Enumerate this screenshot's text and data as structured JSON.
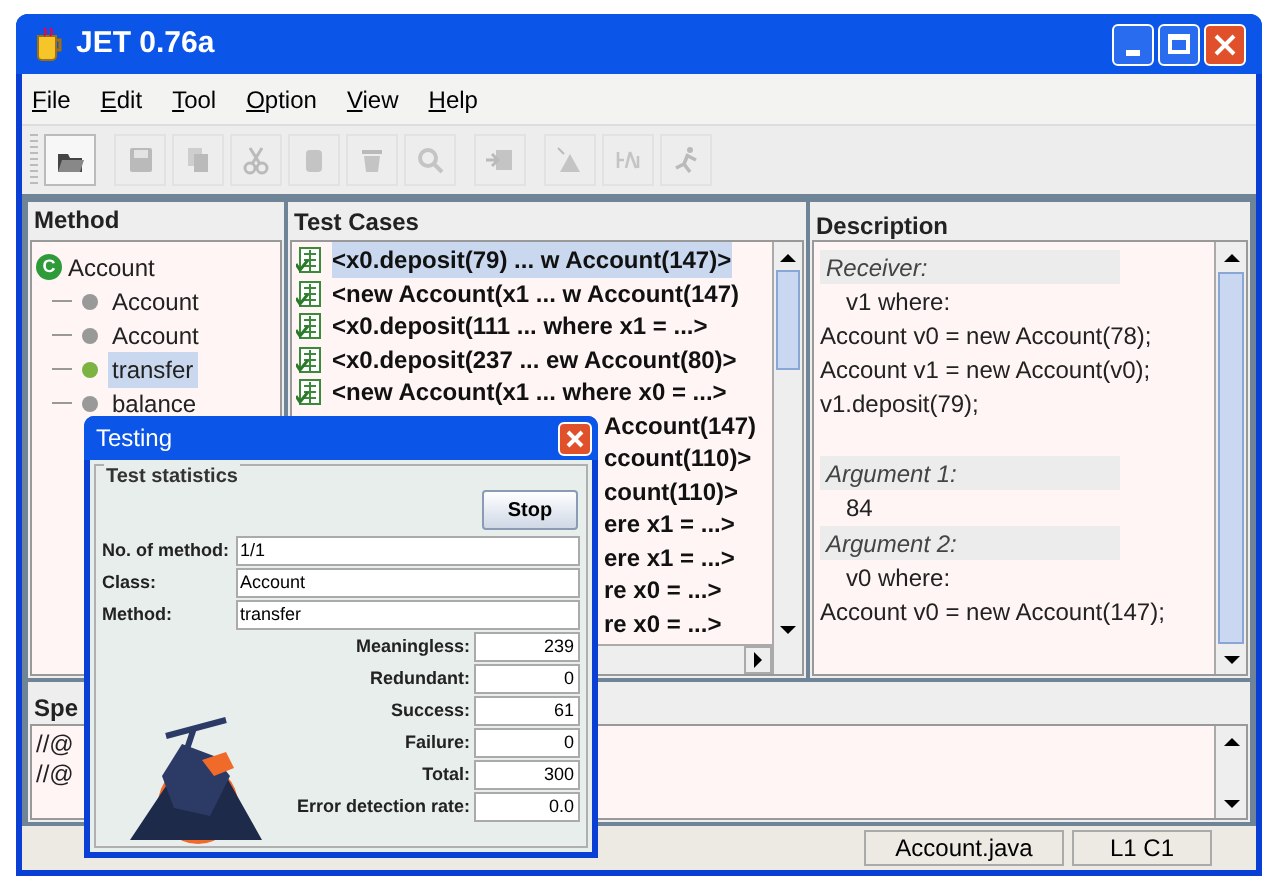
{
  "window": {
    "title": "JET 0.76a"
  },
  "menu": [
    "File",
    "Edit",
    "Tool",
    "Option",
    "View",
    "Help"
  ],
  "toolbar": [
    {
      "disabled": false
    },
    {
      "disabled": true
    },
    {
      "disabled": true
    },
    {
      "disabled": true
    },
    {
      "disabled": true
    },
    {
      "disabled": true
    },
    {
      "disabled": true
    },
    {
      "disabled": true
    },
    {
      "disabled": true
    },
    {
      "disabled": true
    },
    {
      "disabled": true
    }
  ],
  "method_panel": {
    "title": "Method",
    "root": {
      "icon": "C",
      "label": "Account",
      "children": [
        {
          "label": "Account",
          "selected": false
        },
        {
          "label": "Account",
          "selected": false
        },
        {
          "label": "transfer",
          "selected": true
        },
        {
          "label": "balance",
          "selected": false
        }
      ]
    }
  },
  "test_cases": {
    "title": "Test Cases",
    "rows": [
      {
        "label": "<x0.deposit(79) ... w Account(147)>",
        "covered": false,
        "selected": true
      },
      {
        "label": "<new Account(x1 ... w Account(147)",
        "covered": false,
        "selected": false
      },
      {
        "label": "<x0.deposit(111 ... where x1 = ...>",
        "covered": false,
        "selected": false
      },
      {
        "label": "<x0.deposit(237 ... ew Account(80)>",
        "covered": false,
        "selected": false
      },
      {
        "label": "<new Account(x1 ... where x0 = ...>",
        "covered": false,
        "selected": false
      },
      {
        "label": "Account(147)",
        "covered": true,
        "selected": false
      },
      {
        "label": "ccount(110)>",
        "covered": true,
        "selected": false
      },
      {
        "label": "count(110)>",
        "covered": true,
        "selected": false
      },
      {
        "label": "ere x1 = ...>",
        "covered": true,
        "selected": false
      },
      {
        "label": "ere x1 = ...>",
        "covered": true,
        "selected": false
      },
      {
        "label": "re x0 = ...>",
        "covered": true,
        "selected": false
      },
      {
        "label": "re x0 = ...>",
        "covered": true,
        "selected": false
      }
    ]
  },
  "description": {
    "title": "Description",
    "lines": [
      {
        "kind": "label",
        "text": "Receiver:"
      },
      {
        "kind": "value",
        "text": "v1 where:"
      },
      {
        "kind": "code",
        "text": "Account v0 = new Account(78);"
      },
      {
        "kind": "code",
        "text": "Account v1 = new Account(v0);"
      },
      {
        "kind": "code",
        "text": "v1.deposit(79);"
      },
      {
        "kind": "blank"
      },
      {
        "kind": "label",
        "text": "Argument 1:"
      },
      {
        "kind": "value",
        "text": "84"
      },
      {
        "kind": "label",
        "text": "Argument 2:"
      },
      {
        "kind": "value",
        "text": "v0 where:"
      },
      {
        "kind": "code",
        "text": "Account v0 = new Account(147);"
      }
    ]
  },
  "spec_panel": {
    "title": "Spe",
    "lines": [
      "//@",
      "//@"
    ]
  },
  "status_bar": [
    "Account.java",
    "L1 C1"
  ],
  "dialog": {
    "title": "Testing",
    "group": "Test statistics",
    "stop_button": "Stop",
    "fields": [
      {
        "kind": "text",
        "label": "No. of method:",
        "value": "1/1"
      },
      {
        "kind": "text",
        "label": "Class:",
        "value": "Account"
      },
      {
        "kind": "text",
        "label": "Method:",
        "value": "transfer"
      },
      {
        "kind": "number",
        "label": "Meaningless:",
        "value": "239"
      },
      {
        "kind": "number",
        "label": "Redundant:",
        "value": "0"
      },
      {
        "kind": "number",
        "label": "Success:",
        "value": "61"
      },
      {
        "kind": "number",
        "label": "Failure:",
        "value": "0"
      },
      {
        "kind": "number",
        "label": "Total:",
        "value": "300"
      },
      {
        "kind": "number",
        "label": "Error detection rate:",
        "value": "0.0"
      }
    ]
  }
}
